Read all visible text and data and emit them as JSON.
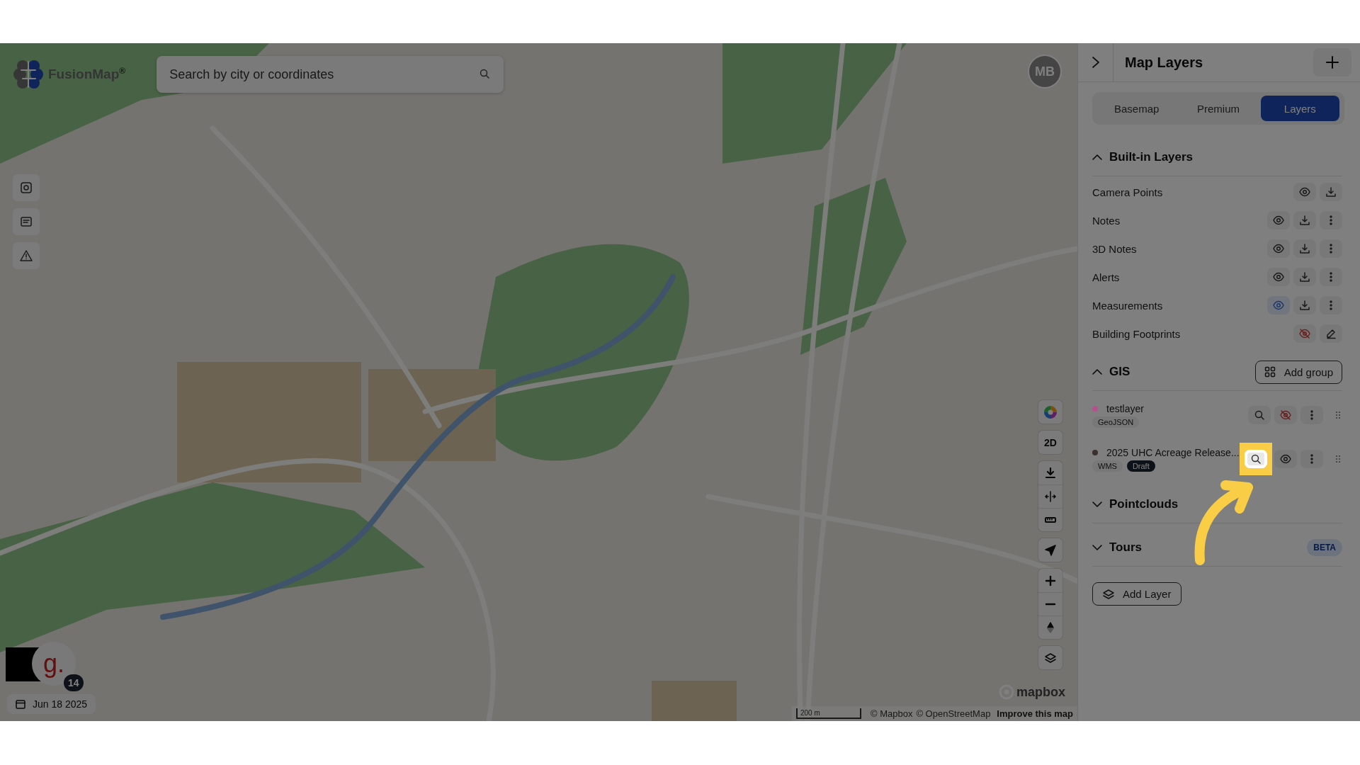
{
  "brand": {
    "name": "FusionMap$^{®}$"
  },
  "search": {
    "placeholder": "Search by city or coordinates"
  },
  "avatar": {
    "initials": "MB"
  },
  "view_mode": {
    "label": "2D"
  },
  "user_badge": {
    "letter": "g.",
    "count": "14"
  },
  "date": {
    "label": "Jun 18 2025"
  },
  "map_logo": {
    "label": "mapbox"
  },
  "scale": {
    "label": "200 m"
  },
  "attribution": [
    {
      "label": "© Mapbox",
      "kind": "plain"
    },
    {
      "label": "© OpenStreetMap",
      "kind": "plain"
    },
    {
      "label": "Improve this map",
      "kind": "link"
    }
  ],
  "panel": {
    "title": "Map Layers",
    "tabs": [
      {
        "label": "Basemap",
        "selected": false
      },
      {
        "label": "Premium",
        "selected": false
      },
      {
        "label": "Layers",
        "selected": true
      }
    ],
    "sections": [
      {
        "title": "Built-in Layers",
        "expanded": true,
        "rows": [
          {
            "name": "Camera Points",
            "actions": [
              {
                "kind": "visibility",
                "visible": true,
                "highlighted": false
              },
              {
                "kind": "download"
              }
            ]
          },
          {
            "name": "Notes",
            "actions": [
              {
                "kind": "visibility",
                "visible": true,
                "highlighted": false
              },
              {
                "kind": "download"
              },
              {
                "kind": "menu"
              }
            ]
          },
          {
            "name": "3D Notes",
            "actions": [
              {
                "kind": "visibility",
                "visible": true,
                "highlighted": false
              },
              {
                "kind": "download"
              },
              {
                "kind": "menu"
              }
            ]
          },
          {
            "name": "Alerts",
            "actions": [
              {
                "kind": "visibility",
                "visible": true,
                "highlighted": false
              },
              {
                "kind": "download"
              },
              {
                "kind": "menu"
              }
            ]
          },
          {
            "name": "Measurements",
            "actions": [
              {
                "kind": "visibility",
                "visible": true,
                "highlighted": true
              },
              {
                "kind": "download"
              },
              {
                "kind": "menu"
              }
            ]
          },
          {
            "name": "Building Footprints",
            "actions": [
              {
                "kind": "visibility",
                "visible": false
              },
              {
                "kind": "edit"
              }
            ]
          }
        ]
      },
      {
        "title": "GIS",
        "expanded": true,
        "button": "Add group",
        "layers": [
          {
            "name": "testlayer",
            "color": "#b5518f",
            "tags": [
              {
                "label": "GeoJSON",
                "kind": "type"
              }
            ],
            "actions": [
              {
                "kind": "zoom",
                "annotated": false
              },
              {
                "kind": "visibility",
                "visible": false
              },
              {
                "kind": "menu"
              },
              {
                "kind": "drag"
              }
            ]
          },
          {
            "name": "2025 UHC Acreage Release...",
            "color": "#3a302c",
            "tags": [
              {
                "label": "WMS",
                "kind": "type"
              },
              {
                "label": "Draft",
                "kind": "status"
              }
            ],
            "actions": [
              {
                "kind": "zoom",
                "annotated": true
              },
              {
                "kind": "visibility",
                "visible": true,
                "highlighted": false
              },
              {
                "kind": "menu"
              },
              {
                "kind": "drag"
              }
            ]
          }
        ]
      },
      {
        "title": "Pointclouds",
        "expanded": false
      },
      {
        "title": "Tours",
        "expanded": false,
        "badge": "BETA"
      }
    ],
    "add_button": "Add Layer"
  }
}
